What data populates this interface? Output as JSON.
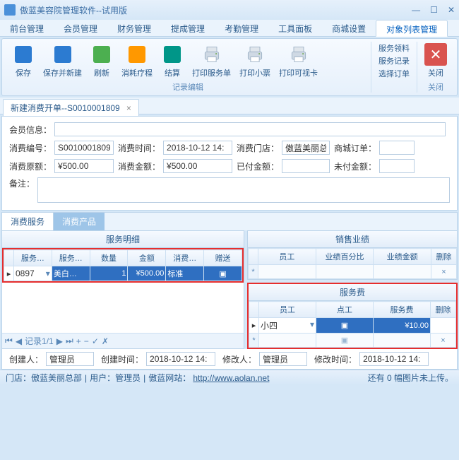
{
  "window": {
    "title": "傲蓝美容院管理软件--试用版"
  },
  "menu": [
    "前台管理",
    "会员管理",
    "财务管理",
    "提成管理",
    "考勤管理",
    "工具面板",
    "商城设置",
    "对象列表管理"
  ],
  "menu_active": 7,
  "ribbon": {
    "group1": [
      {
        "label": "保存",
        "color": "#2c7bd1"
      },
      {
        "label": "保存并新建",
        "color": "#2c7bd1"
      },
      {
        "label": "刷新",
        "color": "#4caf50"
      },
      {
        "label": "消耗疗程",
        "color": "#ff9800"
      },
      {
        "label": "结算",
        "color": "#009688"
      },
      {
        "label": "打印服务单",
        "printer": true
      },
      {
        "label": "打印小票",
        "printer": true
      },
      {
        "label": "打印可视卡",
        "printer": true
      }
    ],
    "textcol": [
      "服务领料",
      "服务记录",
      "选择订单"
    ],
    "group1_title": "记录编辑",
    "close_label": "关闭",
    "close_title": "关闭"
  },
  "doctab": {
    "label": "新建消费开单--S0010001809"
  },
  "form": {
    "member_label": "会员信息：",
    "code_label": "消费编号：",
    "code": "S0010001809",
    "time_label": "消费时间：",
    "time": "2018-10-12 14:",
    "store_label": "消费门店：",
    "store": "傲蓝美丽总",
    "mall_label": "商城订单：",
    "mall": "",
    "orig_label": "消费原额：",
    "orig": "¥500.00",
    "amt_label": "消费金额：",
    "amt": "¥500.00",
    "paid_label": "已付金额：",
    "paid": "",
    "unpaid_label": "未付金额：",
    "unpaid": "",
    "remark_label": "备注："
  },
  "inner_tabs": [
    "消费服务",
    "消费产品"
  ],
  "detail": {
    "title": "服务明细",
    "cols": [
      "服务…",
      "服务…",
      "数量",
      "金额",
      "消费…",
      "赠送"
    ],
    "row": {
      "code": "0897",
      "name": "美白…",
      "qty": "1",
      "amt": "¥500.00",
      "mode": "标准",
      "gift": "▣"
    },
    "pager": "记录1/1"
  },
  "sales": {
    "title": "销售业绩",
    "cols": [
      "员工",
      "业绩百分比",
      "业绩金额",
      "删除"
    ]
  },
  "fee": {
    "title": "服务费",
    "cols": [
      "员工",
      "点工",
      "服务费",
      "删除"
    ],
    "row": {
      "emp": "小四",
      "pt": "▣",
      "fee": "¥10.00"
    }
  },
  "footer": {
    "creator_label": "创建人：",
    "creator": "管理员",
    "ctime_label": "创建时间：",
    "ctime": "2018-10-12 14:",
    "modifier_label": "修改人：",
    "modifier": "管理员",
    "mtime_label": "修改时间：",
    "mtime": "2018-10-12 14:"
  },
  "status": {
    "store": "门店：傲蓝美丽总部",
    "user": "用户：管理员",
    "site_label": "傲蓝网站：",
    "site_url": "http://www.aolan.net",
    "right": "还有 0 幅图片未上传。"
  }
}
